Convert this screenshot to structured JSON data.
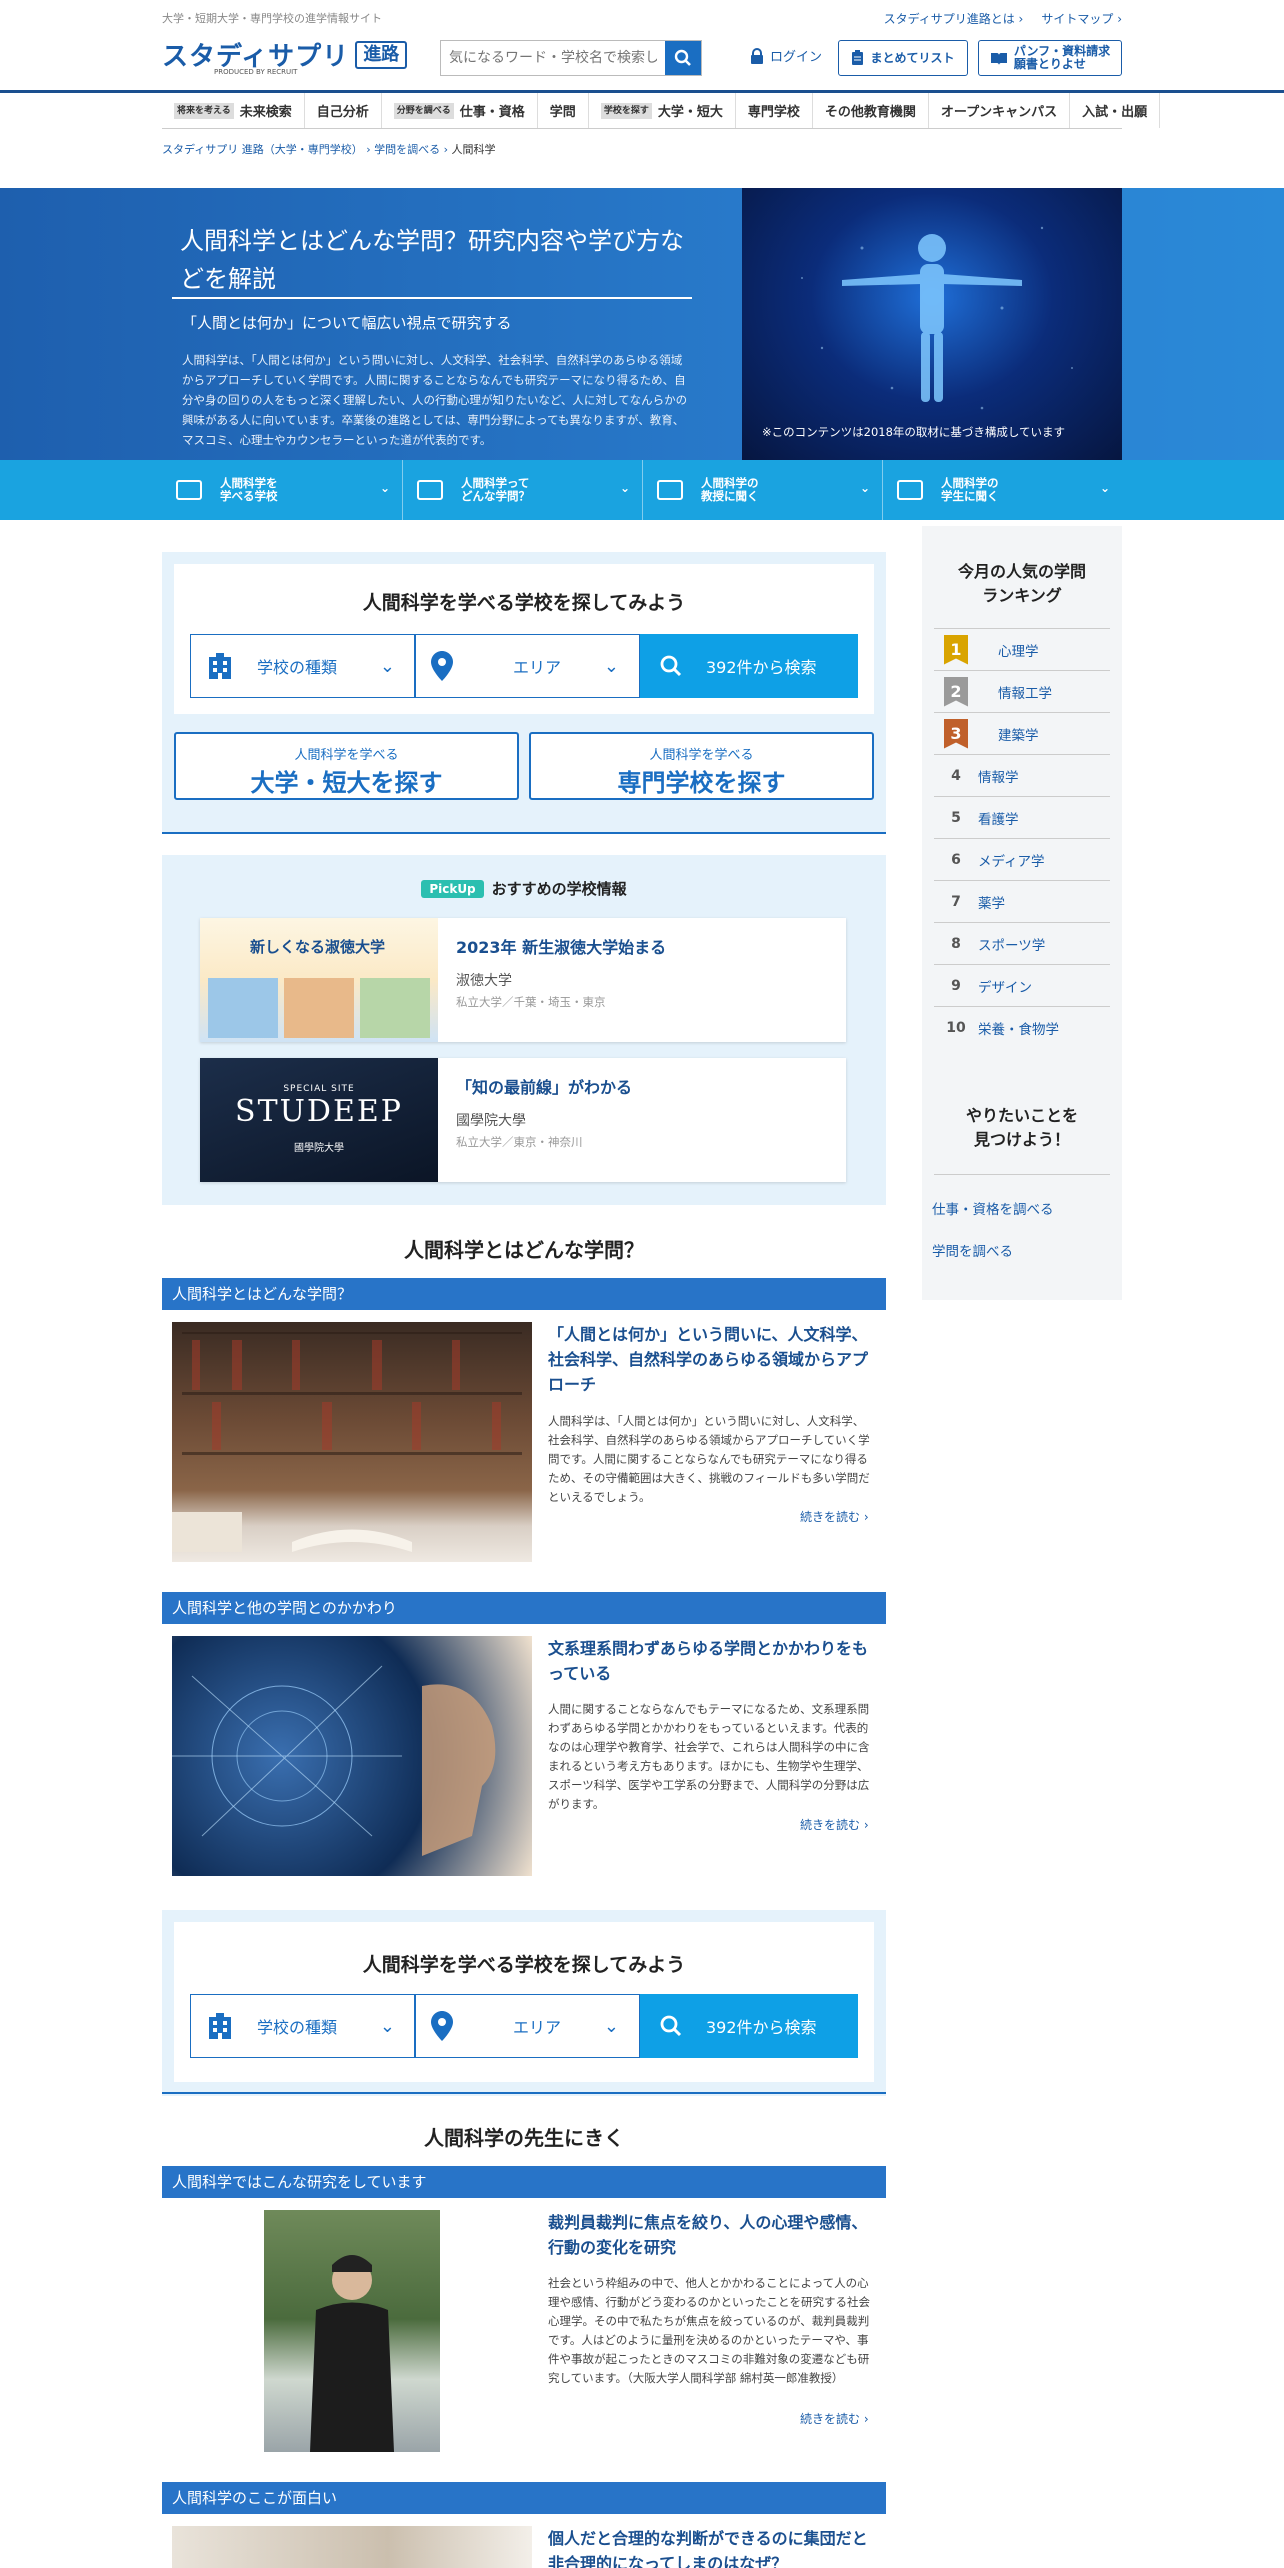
{
  "header": {
    "tagline": "大学・短期大学・専門学校の進学情報サイト",
    "about": "スタディサプリ進路とは",
    "sitemap": "サイトマップ",
    "logo": "スタディサプリ",
    "logo_badge": "進路",
    "logo_produced": "PRODUCED BY RECRUIT",
    "search_placeholder": "気になるワード・学校名で検索しよう",
    "login": "ログイン",
    "list_btn": "まとめてリスト",
    "pamph_btn_1": "パンフ・資料請求",
    "pamph_btn_2": "願書とりよせ"
  },
  "nav": [
    {
      "tag": "将来を考える",
      "label": "未来検索"
    },
    {
      "tag": "",
      "label": "自己分析"
    },
    {
      "tag": "分野を調べる",
      "label": "仕事・資格"
    },
    {
      "tag": "",
      "label": "学問"
    },
    {
      "tag": "学校を探す",
      "label": "大学・短大"
    },
    {
      "tag": "",
      "label": "専門学校"
    },
    {
      "tag": "",
      "label": "その他教育機関"
    },
    {
      "tag": "",
      "label": "オープンキャンパス"
    },
    {
      "tag": "",
      "label": "入試・出願"
    }
  ],
  "breadcrumb": [
    "スタディサプリ 進路（大学・専門学校）",
    "学問を調べる",
    "人間科学"
  ],
  "hero": {
    "title": "人間科学とはどんな学問？研究内容や学び方などを解説",
    "subtitle": "「人間とは何か」について幅広い視点で研究する",
    "text": "人間科学は、「人間とは何か」という問いに対し、人文科学、社会科学、自然科学のあらゆる領域からアプローチしていく学問です。人間に関することならなんでも研究テーマになり得るため、自分や身の回りの人をもっと深く理解したい、人の行動心理が知りたいなど、人に対してなんらかの興味がある人に向いています。卒業後の進路としては、専門分野によっても異なりますが、教育、マスコミ、心理士やカウンセラーといった道が代表的です。",
    "note": "※このコンテンツは2018年の取材に基づき構成しています"
  },
  "subnav": [
    {
      "l1": "人間科学を",
      "l2": "学べる学校"
    },
    {
      "l1": "人間科学って",
      "l2": "どんな学問？"
    },
    {
      "l1": "人間科学の",
      "l2": "教授に聞く"
    },
    {
      "l1": "人間科学の",
      "l2": "学生に聞く"
    }
  ],
  "search": {
    "title": "人間科学を学べる学校を探してみよう",
    "type": "学校の種類",
    "area": "エリア",
    "go": "392件から検索",
    "univ_small": "人間科学を学べる",
    "univ_big": "大学・短大を探す",
    "voc_small": "人間科学を学べる",
    "voc_big": "専門学校を探す"
  },
  "pickup": {
    "badge": "PickUp",
    "title": "おすすめの学校情報",
    "cards": [
      {
        "title": "2023年 新生淑徳大学始まる",
        "name": "淑徳大学",
        "meta": "私立大学／千葉・埼玉・東京",
        "img_title": "新しくなる淑徳大学"
      },
      {
        "title": "「知の最前線」がわかる",
        "name": "國學院大學",
        "meta": "私立大学／東京・神奈川",
        "img_title": "STUDEEP",
        "img_sub": "SPECIAL SITE",
        "img_school": "國學院大學"
      }
    ]
  },
  "about": {
    "heading": "人間科学とはどんな学問？",
    "sections": [
      {
        "band": "人間科学とはどんな学問？",
        "title": "「人間とは何か」という問いに、人文科学、社会科学、自然科学のあらゆる領域からアプローチ",
        "text": "人間科学は、「人間とは何か」という問いに対し、人文科学、社会科学、自然科学のあらゆる領域からアプローチしていく学問です。人間に関することならなんでも研究テーマになり得るため、その守備範囲は大きく、挑戦のフィールドも多い学問だといえるでしょう。",
        "more": "続きを読む"
      },
      {
        "band": "人間科学と他の学問とのかかわり",
        "title": "文系理系問わずあらゆる学問とかかわりをもっている",
        "text": "人間に関することならなんでもテーマになるため、文系理系問わずあらゆる学問とかかわりをもっているといえます。代表的なのは心理学や教育学、社会学で、これらは人間科学の中に含まれるという考え方もあります。ほかにも、生物学や生理学、スポーツ科学、医学や工学系の分野まで、人間科学の分野は広がります。",
        "more": "続きを読む"
      }
    ]
  },
  "teacher": {
    "heading": "人間科学の先生にきく",
    "band": "人間科学ではこんな研究をしています",
    "title": "裁判員裁判に焦点を絞り、人の心理や感情、行動の変化を研究",
    "text": "社会という枠組みの中で、他人とかかわることによって人の心理や感情、行動がどう変わるのかといったことを研究する社会心理学。その中で私たちが焦点を絞っているのが、裁判員裁判です。人はどのように量刑を決めるのかといったテーマや、事件や事故が起こったときのマスコミの非難対象の変遷なども研究しています。（大阪大学人間科学部 綿村英一郎准教授）",
    "more": "続きを読む",
    "band2": "人間科学のここが面白い",
    "title2": "個人だと合理的な判断ができるのに集団だと非合理的になってしまのはなぜ？"
  },
  "sidebar": {
    "title1": "今月の人気の学問",
    "title2": "ランキング",
    "ranks": [
      {
        "n": "1",
        "label": "心理学"
      },
      {
        "n": "2",
        "label": "情報工学"
      },
      {
        "n": "3",
        "label": "建築学"
      },
      {
        "n": "4",
        "label": "情報学"
      },
      {
        "n": "5",
        "label": "看護学"
      },
      {
        "n": "6",
        "label": "メディア学"
      },
      {
        "n": "7",
        "label": "薬学"
      },
      {
        "n": "8",
        "label": "スポーツ学"
      },
      {
        "n": "9",
        "label": "デザイン"
      },
      {
        "n": "10",
        "label": "栄養・食物学"
      }
    ],
    "sub1": "やりたいことを",
    "sub2": "見つけよう！",
    "links": [
      "仕事・資格を調べる",
      "学問を調べる"
    ]
  },
  "colors": {
    "brand": "#1a5ca8",
    "hero": "#2a7fd0",
    "accent": "#0ea0e6"
  }
}
